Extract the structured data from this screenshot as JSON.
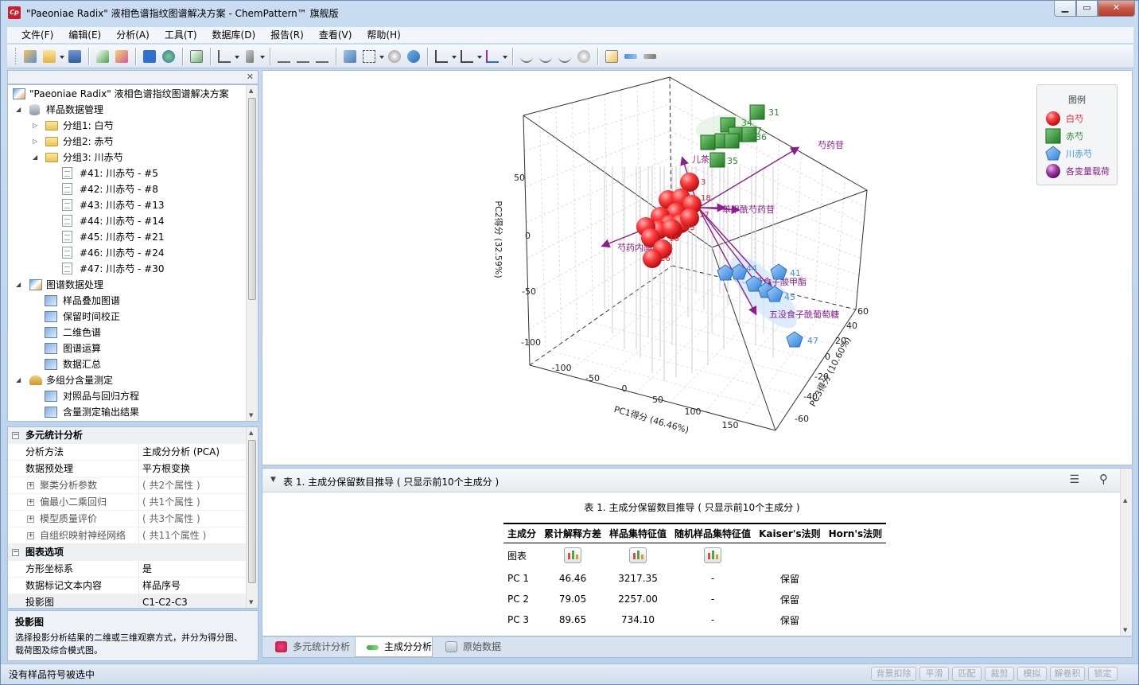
{
  "window": {
    "title": "\"Paeoniae Radix\" 液相色谱指纹图谱解决方案 - ChemPattern™ 旗舰版",
    "app_icon": "Cp"
  },
  "menu": [
    "文件(F)",
    "编辑(E)",
    "分析(A)",
    "工具(T)",
    "数据库(D)",
    "报告(R)",
    "查看(V)",
    "帮助(H)"
  ],
  "tree": {
    "root": "\"Paeoniae Radix\" 液相色谱指纹图谱解决方案",
    "sample_mgmt": "样品数据管理",
    "groups": [
      "分组1: 白芍",
      "分组2: 赤芍",
      "分组3: 川赤芍"
    ],
    "samples": [
      "#41: 川赤芍 - #5",
      "#42: 川赤芍 - #8",
      "#43: 川赤芍 - #13",
      "#44: 川赤芍 - #14",
      "#45: 川赤芍 - #21",
      "#46: 川赤芍 - #24",
      "#47: 川赤芍 - #30"
    ],
    "spectrum": "图谱数据处理",
    "spectrum_items": [
      "样品叠加图谱",
      "保留时间校正",
      "二维色谱",
      "图谱运算",
      "数据汇总"
    ],
    "multi": "多组分含量测定",
    "multi_items": [
      "对照品与回归方程",
      "含量测定输出结果"
    ]
  },
  "props": {
    "group1": "多元统计分析",
    "rows1": [
      {
        "k": "分析方法",
        "v": "主成分分析 (PCA)"
      },
      {
        "k": "数据预处理",
        "v": "平方根变换"
      }
    ],
    "sub": [
      {
        "k": "聚类分析参数",
        "v": "( 共2个属性 )"
      },
      {
        "k": "偏最小二乘回归",
        "v": "( 共1个属性 )"
      },
      {
        "k": "模型质量评价",
        "v": "( 共3个属性 )"
      },
      {
        "k": "自组织映射神经网络",
        "v": "( 共11个属性 )"
      }
    ],
    "group2": "图表选项",
    "rows2": [
      {
        "k": "方形坐标系",
        "v": "是"
      },
      {
        "k": "数据标记文本内容",
        "v": "样品序号"
      },
      {
        "k": "投影图",
        "v": "C1-C2-C3"
      }
    ]
  },
  "description": {
    "title": "投影图",
    "text": "选择投影分析结果的二维或三维观察方式，并分为得分图、载荷图及综合模式图。"
  },
  "legend": {
    "title": "图例",
    "items": [
      {
        "label": "白芍",
        "color": "#e8262d",
        "shape": "sphere"
      },
      {
        "label": "赤芍",
        "color": "#2e8b2e",
        "shape": "cube"
      },
      {
        "label": "川赤芍",
        "color": "#3f8fe0",
        "shape": "pentagon"
      },
      {
        "label": "各变量载荷",
        "color": "#8b1e8b",
        "shape": "sphere"
      }
    ]
  },
  "chart_data": {
    "type": "scatter",
    "title": "",
    "xlabel": "PC1得分 (46.46%)",
    "ylabel": "PC2得分 (32.59%)",
    "zlabel": "PC3得分 (10.60%)",
    "x_ticks": [
      "-100",
      "-50",
      "0",
      "50",
      "100",
      "150"
    ],
    "y_ticks": [
      "50",
      "0",
      "-50",
      "-100"
    ],
    "z_ticks": [
      "60",
      "40",
      "20",
      "0",
      "-20",
      "-40",
      "-60"
    ],
    "series": [
      {
        "name": "白芍",
        "labels": [
          "3",
          "18",
          "17",
          "23",
          "16",
          "4",
          "16"
        ]
      },
      {
        "name": "赤芍",
        "labels": [
          "31",
          "34",
          "37",
          "36",
          "35"
        ]
      },
      {
        "name": "川赤芍",
        "labels": [
          "44",
          "41",
          "45",
          "47"
        ]
      }
    ],
    "loadings": [
      "芍药苷",
      "儿茶素",
      "苯甲酰芍药苷",
      "芍药内酯苷",
      "没食子酸甲酯",
      "五没食子酰葡萄糖"
    ]
  },
  "table": {
    "header": "表 1. 主成分保留数目推导 ( 只显示前10个主成分 )",
    "caption": "表 1. 主成分保留数目推导 ( 只显示前10个主成分 )",
    "columns": [
      "主成分",
      "累计解释方差",
      "样品集特征值",
      "随机样品集特征值",
      "Kaiser's法则",
      "Horn's法则"
    ],
    "chart_row_label": "图表",
    "rows": [
      [
        "PC 1",
        "46.46",
        "3217.35",
        "-",
        "保留",
        ""
      ],
      [
        "PC 2",
        "79.05",
        "2257.00",
        "-",
        "保留",
        ""
      ],
      [
        "PC 3",
        "89.65",
        "734.10",
        "-",
        "保留",
        ""
      ]
    ]
  },
  "tabs": [
    "多元统计分析",
    "主成分分析",
    "原始数据"
  ],
  "status": {
    "text": "没有样品符号被选中",
    "buttons": [
      "背景扣除",
      "平滑",
      "匹配",
      "裁剪",
      "模拟",
      "解卷积",
      "锁定"
    ]
  }
}
